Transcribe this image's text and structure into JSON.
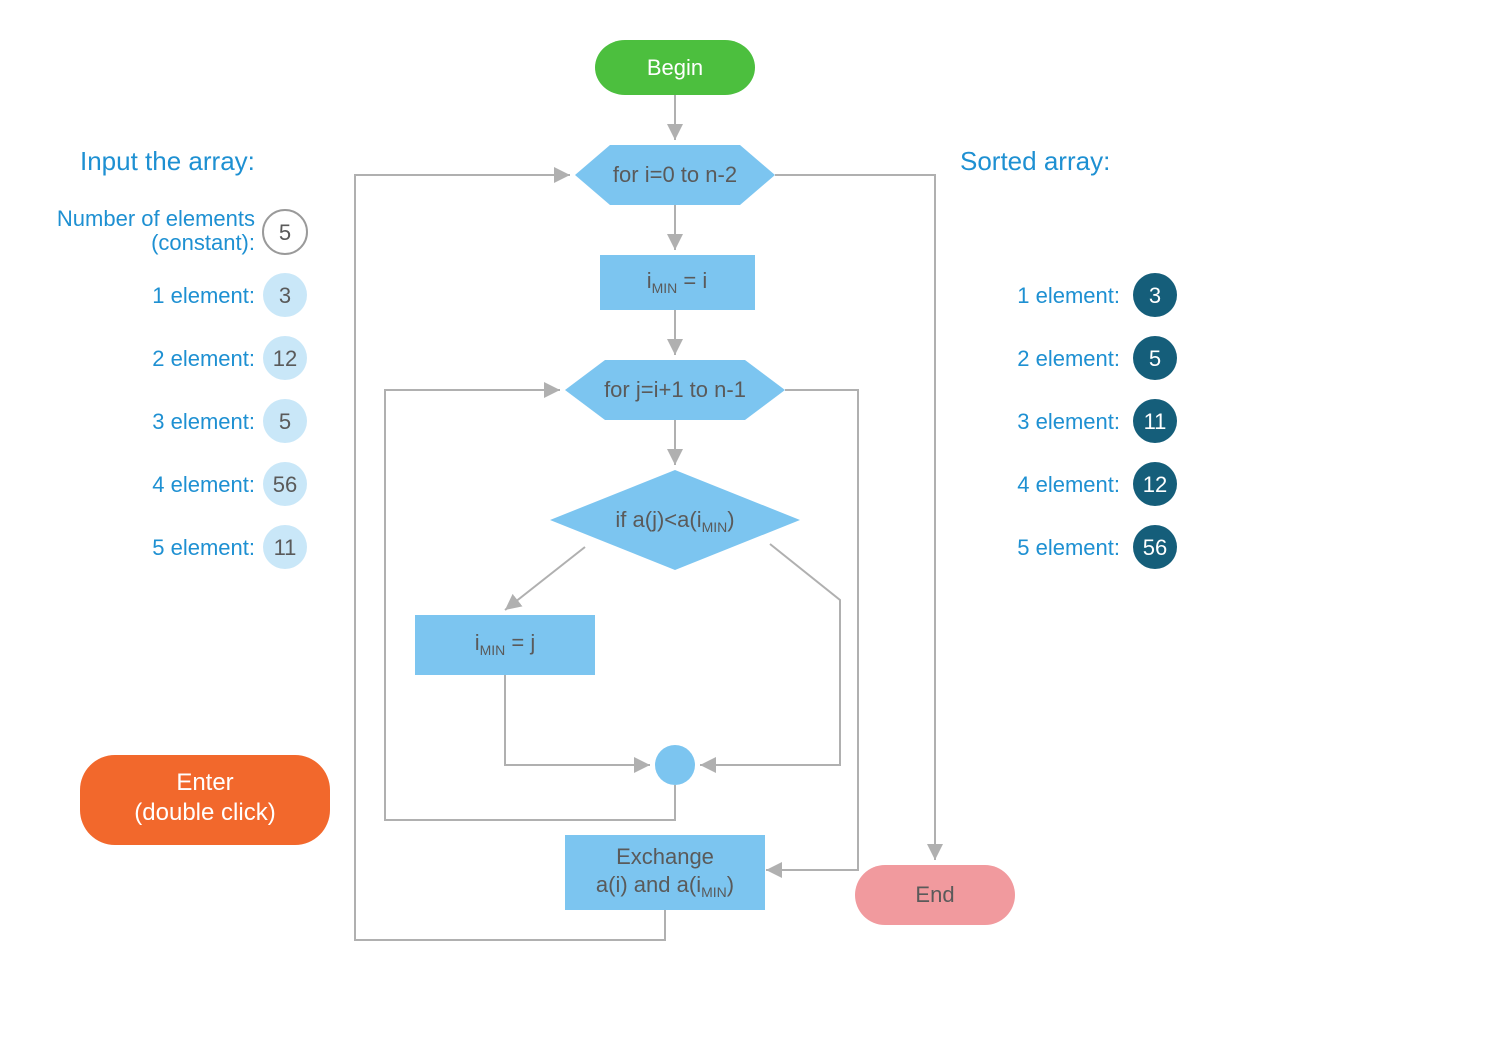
{
  "left": {
    "title": "Input the array:",
    "num_elements_label_top": "Number of elements",
    "num_elements_label_bottom": "(constant):",
    "num_elements_value": "5",
    "items": [
      {
        "label": "1 element:",
        "value": "3"
      },
      {
        "label": "2 element:",
        "value": "12"
      },
      {
        "label": "3 element:",
        "value": "5"
      },
      {
        "label": "4 element:",
        "value": "56"
      },
      {
        "label": "5 element:",
        "value": "11"
      }
    ]
  },
  "right": {
    "title": "Sorted array:",
    "items": [
      {
        "label": "1 element:",
        "value": "3"
      },
      {
        "label": "2 element:",
        "value": "5"
      },
      {
        "label": "3 element:",
        "value": "11"
      },
      {
        "label": "4 element:",
        "value": "12"
      },
      {
        "label": "5 element:",
        "value": "56"
      }
    ]
  },
  "enter": {
    "line1": "Enter",
    "line2": "(double click)"
  },
  "flow": {
    "begin": "Begin",
    "end": "End",
    "for_i": "for i=0 to n-2",
    "imin_eq_i": {
      "pre": "i",
      "sub": "MIN",
      "post": " = i"
    },
    "for_j": "for j=i+1 to n-1",
    "if_cond": {
      "pre": "if a(j)<a(i",
      "sub": "MIN",
      "post": ")"
    },
    "imin_eq_j": {
      "pre": "i",
      "sub": "MIN",
      "post": " = j"
    },
    "exchange": {
      "line1": "Exchange",
      "line2_pre": "a(i) and a(i",
      "line2_sub": "MIN",
      "line2_post": ")"
    }
  }
}
